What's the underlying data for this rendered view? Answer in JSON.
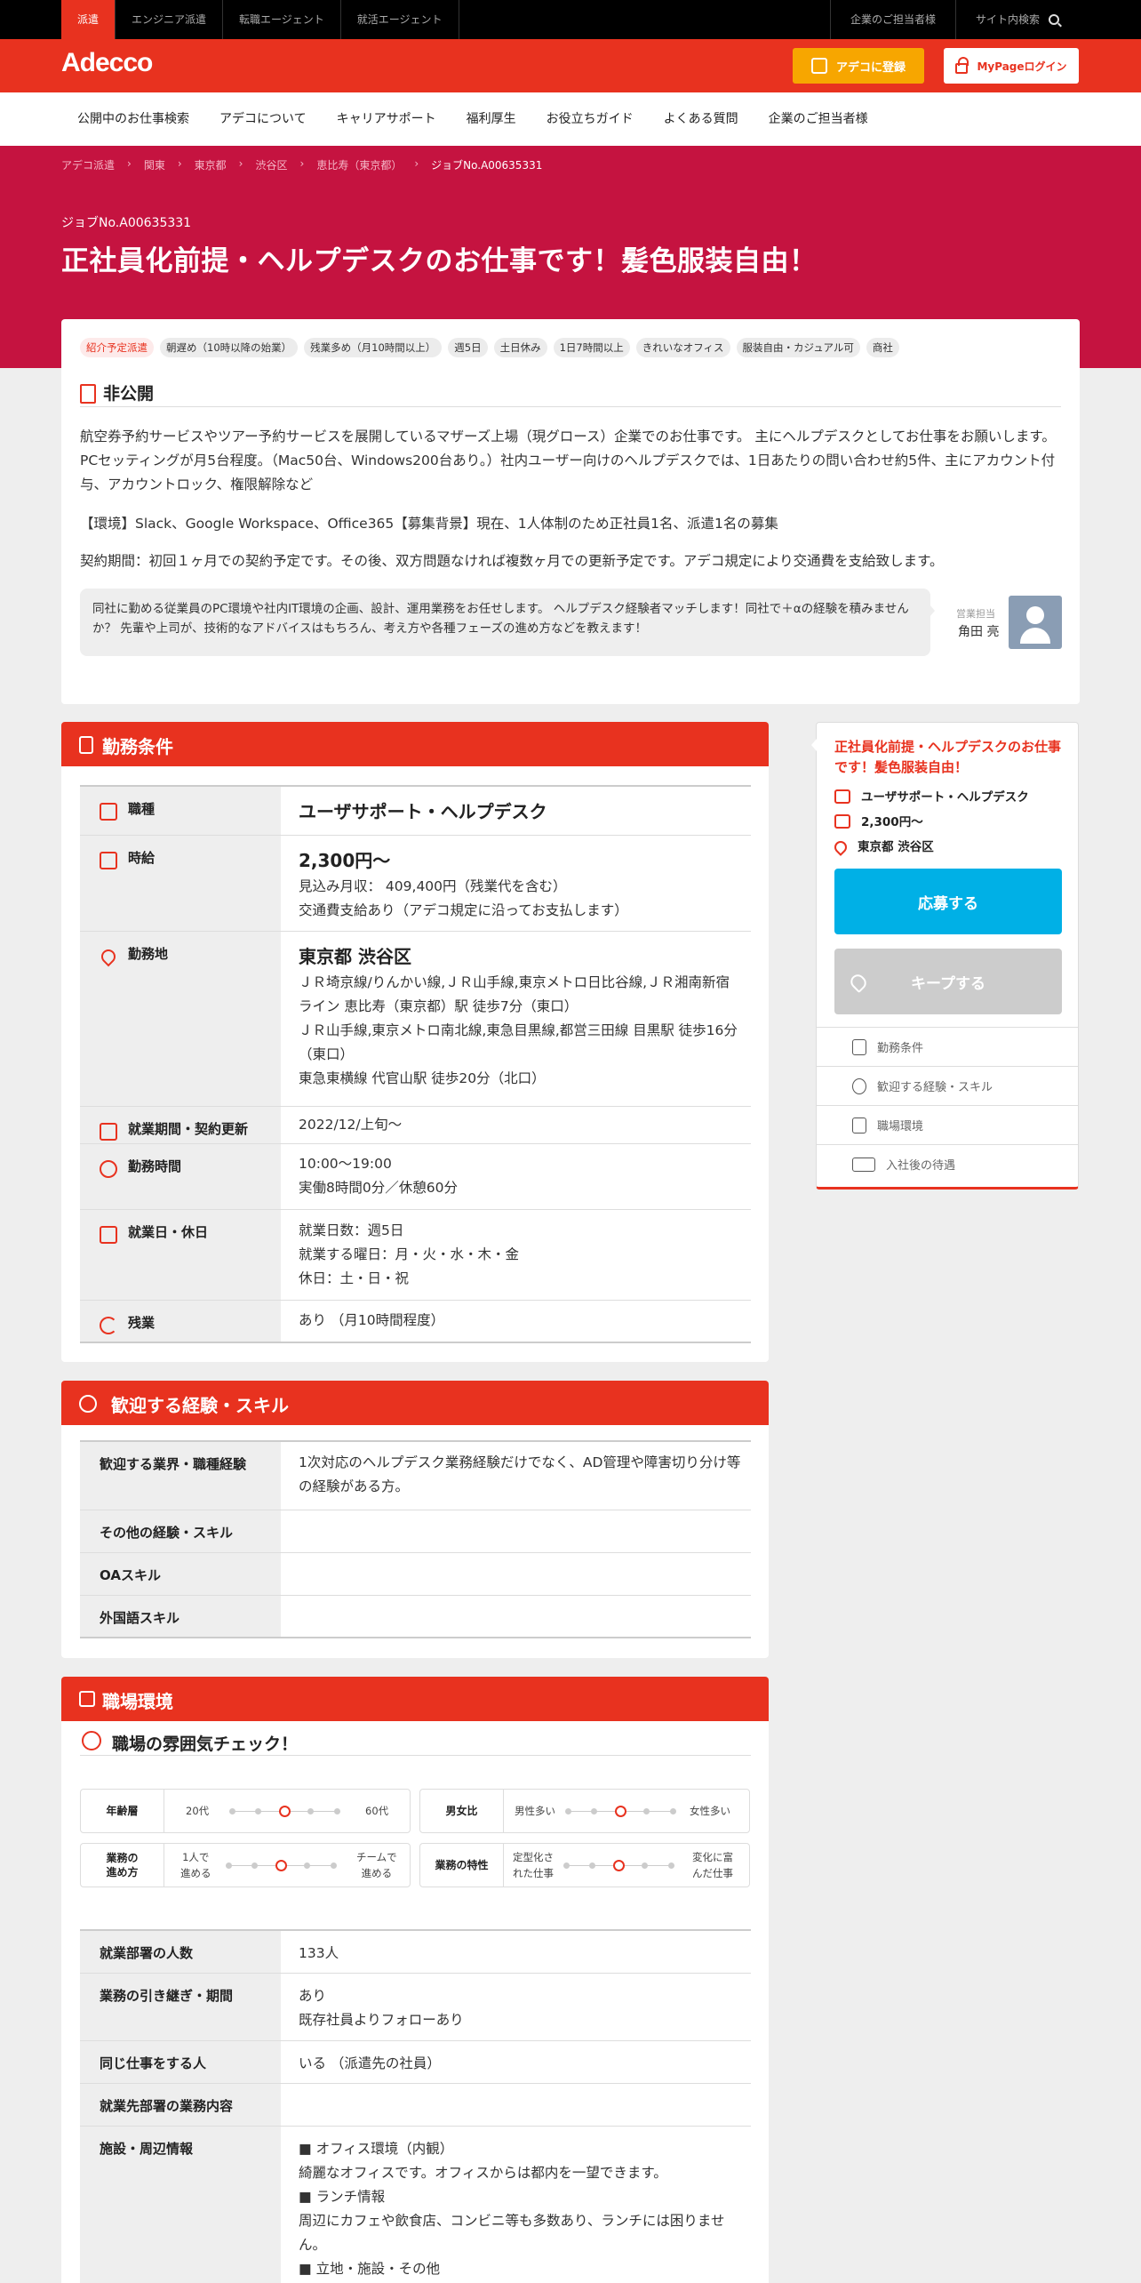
{
  "topbar": {
    "tabs": [
      "派遣",
      "エンジニア派遣",
      "転職エージェント",
      "就活エージェント"
    ],
    "right": [
      "企業のご担当者様",
      "サイト内検索"
    ]
  },
  "header": {
    "logo": "Adecco",
    "register": "アデコに登録",
    "login": "MyPageログイン"
  },
  "nav": [
    "公開中のお仕事検索",
    "アデコについて",
    "キャリアサポート",
    "福利厚生",
    "お役立ちガイド",
    "よくある質問",
    "企業のご担当者様"
  ],
  "breadcrumb": [
    "アデコ派遣",
    "関東",
    "東京都",
    "渋谷区",
    "恵比寿（東京都）",
    "ジョブNo.A00635331"
  ],
  "job": {
    "no": "ジョブNo.A00635331",
    "title": "正社員化前提・ヘルプデスクのお仕事です！髪色服装自由！"
  },
  "tags": [
    "紹介予定派遣",
    "朝遅め（10時以降の始業）",
    "残業多め（月10時間以上）",
    "週5日",
    "土日休み",
    "1日7時間以上",
    "きれいなオフィス",
    "服装自由・カジュアル可",
    "商社"
  ],
  "company": {
    "label": "非公開",
    "p1": "航空券予約サービスやツアー予約サービスを展開しているマザーズ上場（現グロース）企業でのお仕事です。 主にヘルプデスクとしてお仕事をお願いします。PCセッティングが月5台程度。（Mac50台、Windows200台あり。）社内ユーザー向けのヘルプデスクでは、1日あたりの問い合わせ約5件、主にアカウント付与、アカウントロック、権限解除など",
    "p2": "【環境】Slack、Google Workspace、Office365【募集背景】現在、1人体制のため正社員1名、派遣1名の募集",
    "p3": "契約期間：初回１ヶ月での契約予定です。その後、双方問題なければ複数ヶ月での更新予定です。アデコ規定により交通費を支給致します。",
    "message": "同社に勤める従業員のPC環境や社内IT環境の企画、設計、運用業務をお任せします。 ヘルプデスク経験者マッチします！同社で＋αの経験を積みませんか？ 先輩や上司が、技術的なアドバイスはもちろん、考え方や各種フェーズの進め方などを教えます！",
    "staff_label": "営業担当",
    "staff_name": "角田 亮"
  },
  "conditions": {
    "heading": "勤務条件",
    "rows": [
      {
        "k": "職種",
        "big": "ユーザサポート・ヘルプデスク",
        "lines": []
      },
      {
        "k": "時給",
        "big": "2,300円～",
        "lines": [
          "見込み月収： 409,400円（残業代を含む）",
          "交通費支給あり（アデコ規定に沿ってお支払します）"
        ]
      },
      {
        "k": "勤務地",
        "big": "東京都 渋谷区",
        "lines": [
          "ＪＲ埼京線/りんかい線,ＪＲ山手線,東京メトロ日比谷線,ＪＲ湘南新宿ライン 恵比寿（東京都）駅 徒歩7分（東口）",
          "ＪＲ山手線,東京メトロ南北線,東急目黒線,都営三田線 目黒駅 徒歩16分（東口）",
          "東急東横線 代官山駅 徒歩20分（北口）"
        ]
      },
      {
        "k": "就業期間・契約更新",
        "big": "",
        "lines": [
          "2022/12/上旬～"
        ]
      },
      {
        "k": "勤務時間",
        "big": "",
        "lines": [
          "10:00～19:00",
          "実働8時間0分／休憩60分"
        ]
      },
      {
        "k": "就業日・休日",
        "big": "",
        "lines": [
          "就業日数：週5日",
          "就業する曜日：月・火・水・木・金",
          "休日：土・日・祝"
        ]
      },
      {
        "k": "残業",
        "big": "",
        "lines": [
          "あり （月10時間程度）"
        ]
      }
    ]
  },
  "skills": {
    "heading": "歓迎する経験・スキル",
    "rows": [
      {
        "k": "歓迎する業界・職種経験",
        "v": "1次対応のヘルプデスク業務経験だけでなく、AD管理や障害切り分け等の経験がある方。"
      },
      {
        "k": "その他の経験・スキル",
        "v": ""
      },
      {
        "k": "OAスキル",
        "v": ""
      },
      {
        "k": "外国語スキル",
        "v": ""
      }
    ]
  },
  "env": {
    "heading": "職場環境",
    "atmosphere": "職場の雰囲気チェック！",
    "gauges": [
      {
        "label": "年齢層",
        "left": "20代",
        "right": "60代",
        "level": 3
      },
      {
        "label": "男女比",
        "left": "男性多い",
        "right": "女性多い",
        "level": 3
      },
      {
        "label": "業務の\n進め方",
        "left": "1人で\n進める",
        "right": "チームで\n進める",
        "level": 3
      },
      {
        "label": "業務の特性",
        "left": "定型化さ\nれた仕事",
        "right": "変化に富\nんだ仕事",
        "level": 3
      }
    ],
    "rows": [
      {
        "k": "就業部署の人数",
        "lines": [
          "133人"
        ]
      },
      {
        "k": "業務の引き継ぎ・期間",
        "lines": [
          "あり",
          "既存社員よりフォローあり"
        ]
      },
      {
        "k": "同じ仕事をする人",
        "lines": [
          "いる （派遣先の社員）"
        ]
      },
      {
        "k": "就業先部署の業務内容",
        "lines": []
      },
      {
        "k": "施設・周辺情報",
        "lines": [
          "■ オフィス環境（内観）",
          "綺麗なオフィスです。オフィスからは都内を一望できます。",
          "■ ランチ情報",
          "周辺にカフェや飲食店、コンビニ等も多数あり、ランチには困りません。",
          "■ 立地・施設・その他"
        ]
      }
    ]
  },
  "sidebar": {
    "title": "正社員化前提・ヘルプデスクのお仕事です！髪色服装自由！",
    "job": "ユーザサポート・ヘルプデスク",
    "wage": "2,300円～",
    "place": "東京都 渋谷区",
    "apply": "応募する",
    "keep": "キープする",
    "links": [
      "勤務条件",
      "歓迎する経験・スキル",
      "職場環境",
      "入社後の待遇"
    ]
  }
}
